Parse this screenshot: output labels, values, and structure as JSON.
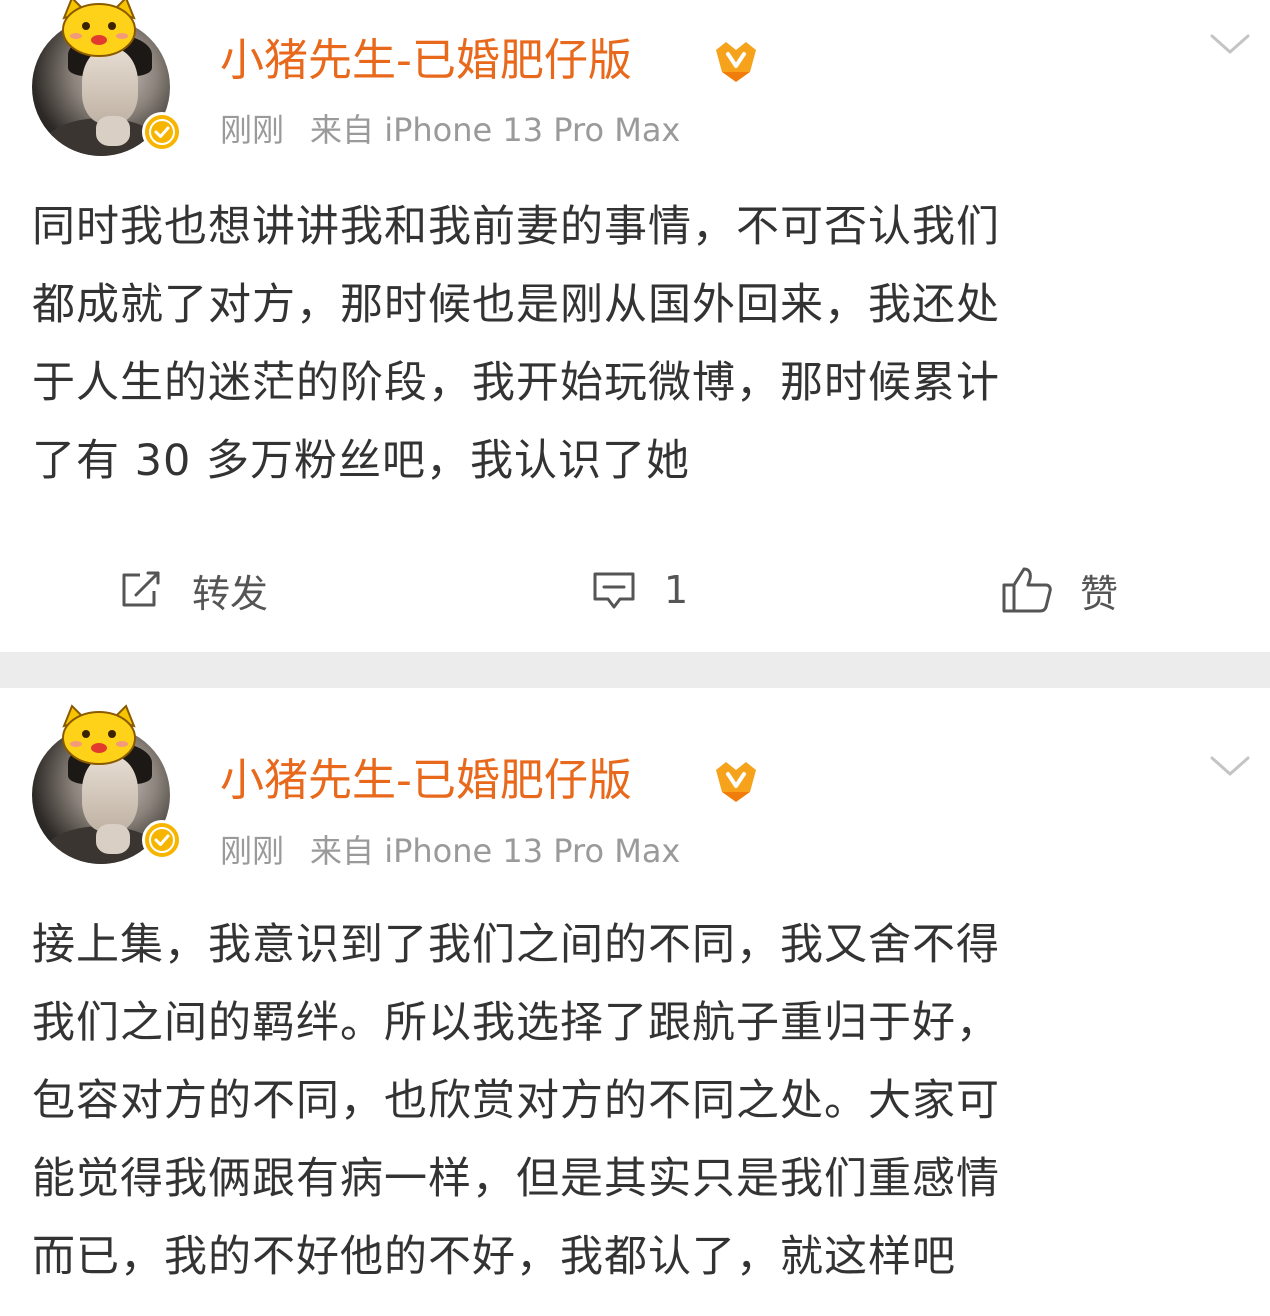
{
  "posts": [
    {
      "username": "小猪先生-已婚肥仔版",
      "time": "刚刚",
      "source": "来自 iPhone 13 Pro Max",
      "content_lines": [
        "同时我也想讲讲我和我前妻的事情，不可否认我们",
        "都成就了对方，那时候也是刚从国外回来，我还处",
        "于人生的迷茫的阶段，我开始玩微博，那时候累计",
        "了有 30 多万粉丝吧，我认识了她"
      ],
      "actions": {
        "repost_label": "转发",
        "comment_count": "1",
        "like_label": "赞"
      }
    },
    {
      "username": "小猪先生-已婚肥仔版",
      "time": "刚刚",
      "source": "来自 iPhone 13 Pro Max",
      "content_lines": [
        "接上集，我意识到了我们之间的不同，我又舍不得",
        "我们之间的羁绊。所以我选择了跟航子重归于好，",
        "包容对方的不同，也欣赏对方的不同之处。大家可",
        "能觉得我俩跟有病一样，但是其实只是我们重感情",
        "而已，我的不好他的不好，我都认了，就这样吧"
      ]
    }
  ],
  "colors": {
    "username": "#e8681c",
    "meta": "#9a9a9a",
    "text": "#333333",
    "separator": "#ececec",
    "verified": "#f7b500"
  },
  "icons": [
    "avatar-sticker-icon",
    "verified-icon",
    "vip-badge-icon",
    "chevron-down-icon",
    "repost-icon",
    "comment-icon",
    "like-icon"
  ]
}
